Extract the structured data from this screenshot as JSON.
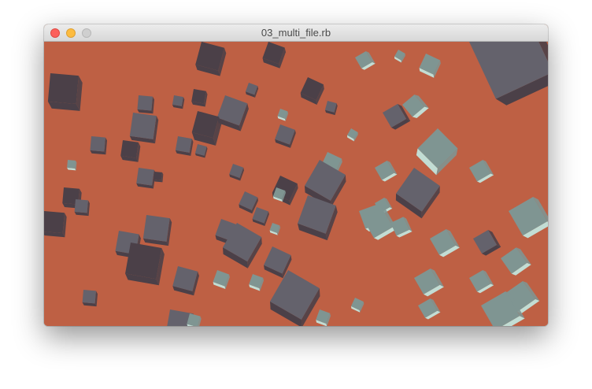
{
  "window": {
    "title": "03_multi_file.rb"
  },
  "viewport": {
    "background_color": "#be6044",
    "box_colors": {
      "dark_face": "#4b4048",
      "mid_face": "#64626c",
      "light_face": "#7f9592",
      "highlight_face": "#c2ddd4"
    }
  },
  "icons": {
    "close": "close-window-icon",
    "minimize": "minimize-window-icon",
    "zoom": "zoom-window-icon"
  }
}
